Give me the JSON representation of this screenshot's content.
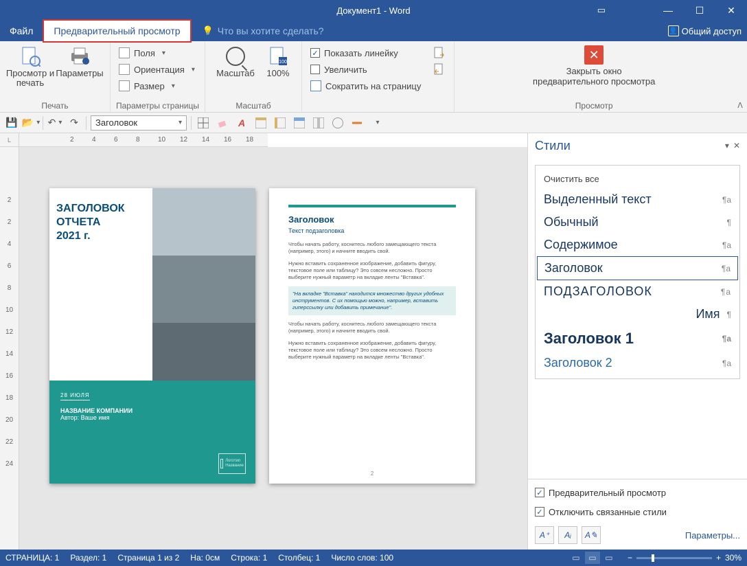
{
  "title": "Документ1 - Word",
  "window": {
    "restore": "❐",
    "min": "—",
    "max": "☐",
    "close": "✕"
  },
  "tabs": {
    "file": "Файл",
    "preview": "Предварительный просмотр",
    "tell_me": "Что вы хотите сделать?",
    "share": "Общий доступ"
  },
  "ribbon": {
    "print": {
      "view_print": "Просмотр и печать",
      "params": "Параметры",
      "group": "Печать"
    },
    "page_setup": {
      "fields": "Поля",
      "orient": "Ориентация",
      "size": "Размер",
      "group": "Параметры страницы"
    },
    "zoom": {
      "zoom": "Масштаб",
      "hundred": "100%",
      "group": "Масштаб"
    },
    "view": {
      "show_ruler": "Показать линейку",
      "magnify": "Увеличить",
      "shrink": "Сократить на страницу"
    },
    "close": {
      "line1": "Закрыть окно",
      "line2": "предварительного просмотра",
      "group": "Просмотр"
    }
  },
  "qat": {
    "style_value": "Заголовок"
  },
  "hruler": [
    "2",
    "4",
    "6",
    "8",
    "10",
    "12",
    "14",
    "16",
    "18"
  ],
  "vruler": [
    "2",
    "2",
    "4",
    "6",
    "8",
    "10",
    "12",
    "14",
    "16",
    "18",
    "20",
    "22",
    "24"
  ],
  "page1": {
    "title1": "ЗАГОЛОВОК",
    "title2": "ОТЧЕТА",
    "title3": "2021 г.",
    "date": "28 ИЮЛЯ",
    "company": "НАЗВАНИЕ КОМПАНИИ",
    "author": "Автор: Ваше имя",
    "logo1": "Логотип",
    "logo2": "Название"
  },
  "page2": {
    "heading": "Заголовок",
    "sub": "Текст подзаголовка",
    "p1": "Чтобы начать работу, коснитесь любого замещающего текста (например, этого) и начните вводить свой.",
    "p2": "Нужно вставить сохраненное изображение, добавить фигуру, текстовое поле или таблицу? Это совсем несложно. Просто выберите нужный параметр на вкладке ленты \"Вставка\".",
    "callout": "\"На вкладке \"Вставка\" находится множество других удобных инструментов. С их помощью можно, например, вставить гиперссылку или добавить примечание\".",
    "p3": "Чтобы начать работу, коснитесь любого замещающего текста (например, этого) и начните вводить свой.",
    "p4": "Нужно вставить сохраненное изображение, добавить фигуру, текстовое поле или таблицу? Это совсем несложно. Просто выберите нужный параметр на вкладке ленты \"Вставка\".",
    "pnum": "2"
  },
  "styles": {
    "title": "Стили",
    "clear": "Очистить все",
    "items": [
      {
        "label": "Выделенный текст",
        "sym": "¶a",
        "cls": "",
        "name": "style-highlighted"
      },
      {
        "label": "Обычный",
        "sym": "¶",
        "cls": "",
        "name": "style-normal"
      },
      {
        "label": "Содержимое",
        "sym": "¶a",
        "cls": "",
        "name": "style-content"
      },
      {
        "label": "Заголовок",
        "sym": "¶a",
        "cls": "sel",
        "name": "style-title"
      },
      {
        "label": "ПОДЗАГОЛОВОК",
        "sym": "¶a",
        "cls": "upper",
        "name": "style-subtitle"
      },
      {
        "label": "Имя",
        "sym": "¶",
        "cls": "name",
        "name": "style-name"
      },
      {
        "label": "Заголовок 1",
        "sym": "¶a",
        "cls": "h1",
        "name": "style-heading1"
      },
      {
        "label": "Заголовок 2",
        "sym": "¶a",
        "cls": "h2",
        "name": "style-heading2"
      }
    ],
    "preview_cb": "Предварительный просмотр",
    "disable_linked": "Отключить связанные стили",
    "params": "Параметры..."
  },
  "status": {
    "page": "СТРАНИЦА: 1",
    "section": "Раздел: 1",
    "page_of": "Страница 1 из 2",
    "pos": "На: 0см",
    "line": "Строка: 1",
    "col": "Столбец: 1",
    "words": "Число слов: 100",
    "zoom": "30%"
  }
}
